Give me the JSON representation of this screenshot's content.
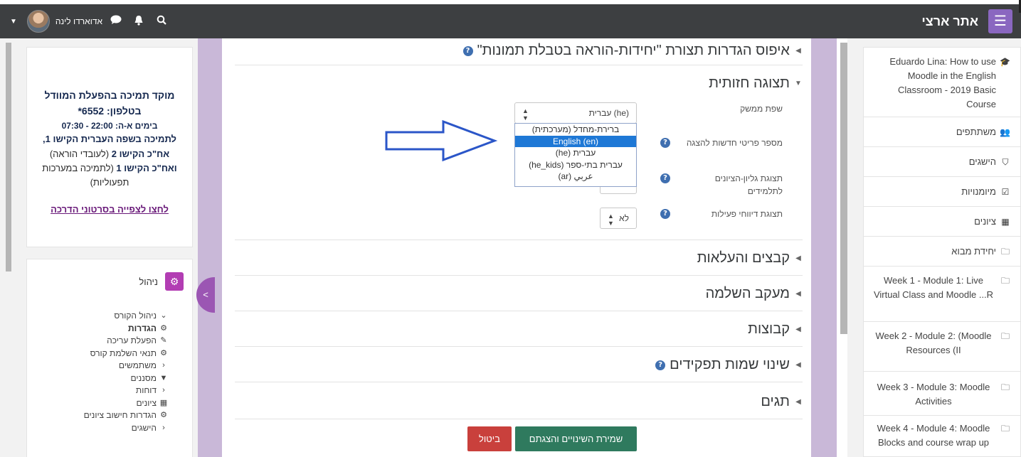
{
  "topbar": {
    "site_name": "אתר ארצי",
    "user_name": "אדוארדו לינה"
  },
  "support_block": {
    "heading_line1": "מוקד תמיכה בהפעלת המוודל",
    "heading_line2": "בטלפון: 6552*",
    "hours": "בימים א-ה: 22:00 - 07:30",
    "line1": "לתמיכה בשפה העברית הקישו 1,",
    "line2_bold": "אח\"כ הקישו 2",
    "line2_rest": " (לעובדי הוראה)",
    "line3_bold": "ואח\"כ הקישו 1",
    "line3_rest": " (לתמיכה במערכות תפעוליות)",
    "link": "לחצו לצפייה בסרטוני הדרכה"
  },
  "admin_block": {
    "title": "ניהול",
    "tree": [
      {
        "icon": "chevron-down",
        "label": "ניהול הקורס",
        "bold": false
      },
      {
        "icon": "gear",
        "label": "הגדרות",
        "bold": true
      },
      {
        "icon": "pencil",
        "label": "הפעלת עריכה",
        "bold": false
      },
      {
        "icon": "gear",
        "label": "תנאי השלמת קורס",
        "bold": false
      },
      {
        "icon": "chevron-left",
        "label": "משתמשים",
        "bold": false
      },
      {
        "icon": "filter",
        "label": "מסננים",
        "bold": false
      },
      {
        "icon": "chevron-left",
        "label": "דוחות",
        "bold": false
      },
      {
        "icon": "table",
        "label": "ציונים",
        "bold": false
      },
      {
        "icon": "gear",
        "label": "הגדרות חישוב ציונים",
        "bold": false
      },
      {
        "icon": "chevron-left",
        "label": "הישגים",
        "bold": false
      }
    ]
  },
  "main": {
    "reset_section": "איפוס הגדרות תצורת \"יחידות-הוראה בטבלת תמונות\"",
    "appearance_section": "תצוגה חזותית",
    "fields": {
      "language_label": "שפת ממשק",
      "language_value": "עברית (he)",
      "news_label": "מספר פריטי חדשות להצגה",
      "gradebook_label": "תצוגת גליון-הציונים לתלמידים",
      "activity_label": "תצוגת דיווחי פעילות",
      "activity_value": "לא"
    },
    "dropdown_options": [
      "ברירת-מחדל (מערכתית)",
      "English (en)",
      "עברית (he)",
      "עברית בתי-ספר (he_kids)",
      "عربي (ar)"
    ],
    "dropdown_selected_index": 1,
    "sections": [
      "קבצים והעלאות",
      "מעקב השלמה",
      "קבוצות",
      "שינוי שמות תפקידים",
      "תגים"
    ],
    "save_button": "שמירת השינויים והצגתם",
    "cancel_button": "ביטול"
  },
  "nav": {
    "course": "Eduardo Lina: How to use Moodle in the English Classroom - 2019 Basic Course",
    "items": [
      {
        "icon": "users",
        "label": "משתתפים"
      },
      {
        "icon": "shield",
        "label": "הישגים"
      },
      {
        "icon": "check-square",
        "label": "מיומנויות"
      },
      {
        "icon": "table",
        "label": "ציונים"
      },
      {
        "icon": "folder",
        "label": "יחידת מבוא"
      },
      {
        "icon": "folder",
        "label": "Week 1 - Module 1: Live Virtual Class and Moodle ...R"
      },
      {
        "icon": "folder",
        "label": "Week 2 - Module 2: (Moodle Resources (II"
      },
      {
        "icon": "folder",
        "label": "Week 3 - Module 3: Moodle Activities"
      },
      {
        "icon": "folder",
        "label": "Week 4 - Module 4: Moodle Blocks and course wrap up"
      }
    ]
  },
  "colors": {
    "topbar": "#3d3f41",
    "accent_purple": "#8a67c0",
    "save_green": "#2f7a5e",
    "cancel_red": "#c9403c",
    "selected_blue": "#1e78d6",
    "arrow_blue": "#2b56c8"
  }
}
